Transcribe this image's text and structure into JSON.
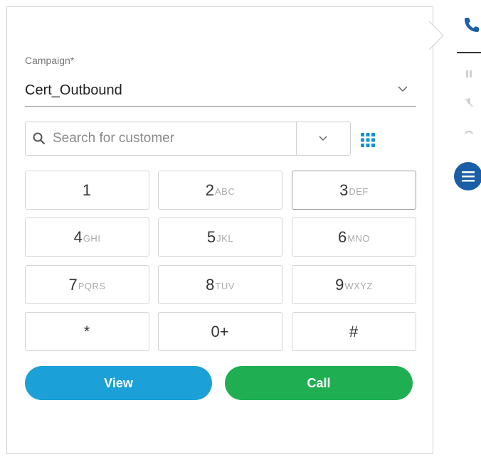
{
  "campaign": {
    "label": "Campaign*",
    "selected": "Cert_Outbound"
  },
  "search": {
    "placeholder": "Search for customer",
    "value": ""
  },
  "keypad": [
    {
      "digit": "1",
      "letters": ""
    },
    {
      "digit": "2",
      "letters": "ABC"
    },
    {
      "digit": "3",
      "letters": "DEF"
    },
    {
      "digit": "4",
      "letters": "GHI"
    },
    {
      "digit": "5",
      "letters": "JKL"
    },
    {
      "digit": "6",
      "letters": "MNO"
    },
    {
      "digit": "7",
      "letters": "PQRS"
    },
    {
      "digit": "8",
      "letters": "TUV"
    },
    {
      "digit": "9",
      "letters": "WXYZ"
    },
    {
      "digit": "*",
      "letters": ""
    },
    {
      "digit": "0+",
      "letters": ""
    },
    {
      "digit": "#",
      "letters": ""
    }
  ],
  "actions": {
    "view_label": "View",
    "call_label": "Call"
  },
  "colors": {
    "view_button": "#1ba0d8",
    "call_button": "#1fae52",
    "accent": "#1a5ea6",
    "dialpad_icon": "#1a8fd6"
  },
  "icons": {
    "search": "search-icon",
    "campaign_dropdown": "chevron-down-icon",
    "search_dropdown": "chevron-down-icon",
    "dialpad": "dialpad-grid-icon",
    "phone": "phone-icon",
    "hold": "pause-icon",
    "mute": "mic-muted-icon",
    "hangup": "hangup-icon",
    "menu": "menu-icon"
  }
}
